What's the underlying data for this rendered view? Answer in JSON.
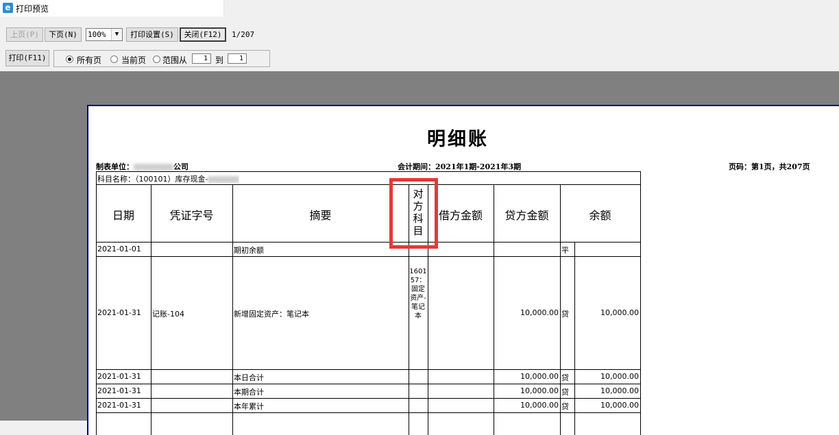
{
  "window": {
    "title": "打印预览",
    "icon": "ie-icon"
  },
  "toolbar": {
    "prev_label": "上页(P)",
    "next_label": "下页(N)",
    "zoom_value": "100%",
    "print_settings_label": "打印设置(S)",
    "close_label": "关闭(F12)",
    "page_indicator": "1/207",
    "print_label": "打印(F11)",
    "range": {
      "all_pages": "所有页",
      "current_page": "当前页",
      "range_from": "范围从",
      "from_value": "1",
      "to_label": "到",
      "to_value": "1",
      "selected": "all_pages"
    }
  },
  "report": {
    "title": "明细账",
    "unit_label": "制表单位：",
    "unit_suffix": "公司",
    "period": "会计期间：2021年1期-2021年3期",
    "page_info": "页码：第1页，共207页",
    "subject_label": "科目名称：（100101）库存现金-",
    "headers": {
      "date": "日期",
      "voucher": "凭证字号",
      "summary": "摘要",
      "counter_account": "对方科目",
      "debit": "借方金额",
      "credit": "贷方金额",
      "balance": "余额"
    },
    "rows": [
      {
        "date": "2021-01-01",
        "voucher": "",
        "summary": "期初余额",
        "counter": "",
        "debit": "",
        "credit": "",
        "direction": "平",
        "balance": ""
      },
      {
        "date": "2021-01-31",
        "voucher": "记账-104",
        "summary": "新增固定资产：笔记本",
        "counter": "160157：固定资产-笔记本",
        "debit": "",
        "credit": "10,000.00",
        "direction": "贷",
        "balance": "10,000.00"
      },
      {
        "date": "2021-01-31",
        "voucher": "",
        "summary": "本日合计",
        "counter": "",
        "debit": "",
        "credit": "10,000.00",
        "direction": "贷",
        "balance": "10,000.00"
      },
      {
        "date": "2021-01-31",
        "voucher": "",
        "summary": "本期合计",
        "counter": "",
        "debit": "",
        "credit": "10,000.00",
        "direction": "贷",
        "balance": "10,000.00"
      },
      {
        "date": "2021-01-31",
        "voucher": "",
        "summary": "本年累计",
        "counter": "",
        "debit": "",
        "credit": "10,000.00",
        "direction": "贷",
        "balance": "10,000.00"
      }
    ]
  },
  "colors": {
    "highlight": "#e53935",
    "page_border": "#000080",
    "preview_bg": "#808080"
  }
}
